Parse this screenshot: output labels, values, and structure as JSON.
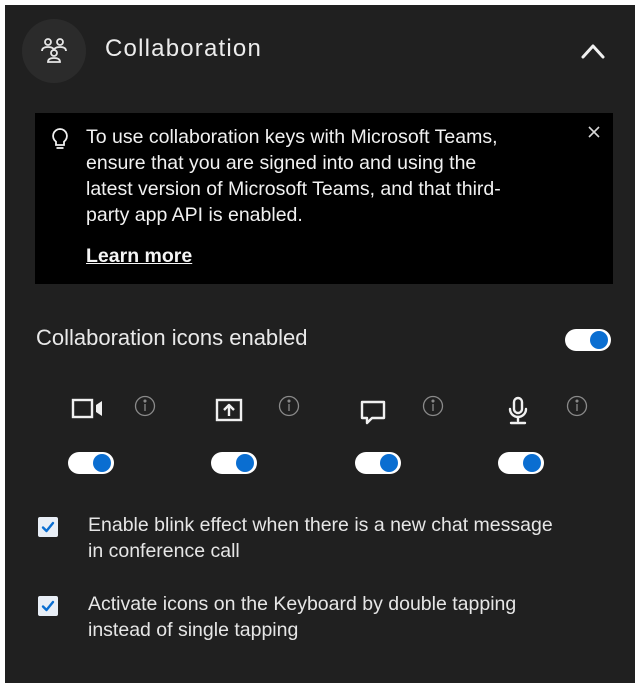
{
  "header": {
    "title": "Collaboration",
    "icon": "people-group-icon",
    "collapse_icon": "chevron-up-icon"
  },
  "banner": {
    "icon": "lightbulb-icon",
    "lines": [
      "To use collaboration keys with Microsoft Teams,",
      "ensure that you are signed into and using the",
      "latest version of Microsoft Teams, and that third-",
      "party app API is enabled."
    ],
    "link": "Learn more",
    "close_icon": "close-icon"
  },
  "master_toggle": {
    "label": "Collaboration icons enabled",
    "on": true
  },
  "icon_toggles": [
    {
      "icon": "video-camera-icon",
      "info_icon": "info-icon",
      "on": true
    },
    {
      "icon": "screen-share-icon",
      "info_icon": "info-icon",
      "on": true
    },
    {
      "icon": "chat-icon",
      "info_icon": "info-icon",
      "on": true
    },
    {
      "icon": "microphone-icon",
      "info_icon": "info-icon",
      "on": true
    }
  ],
  "options": [
    {
      "checked": true,
      "lines": [
        "Enable blink effect when there is a new chat message",
        "in conference call"
      ]
    },
    {
      "checked": true,
      "lines": [
        "Activate icons on the Keyboard by double tapping",
        "instead of single tapping"
      ]
    }
  ],
  "colors": {
    "panel_bg": "#202020",
    "banner_bg": "#000000",
    "toggle_knob": "#0a6ed1",
    "text": "#e9e9e9"
  }
}
